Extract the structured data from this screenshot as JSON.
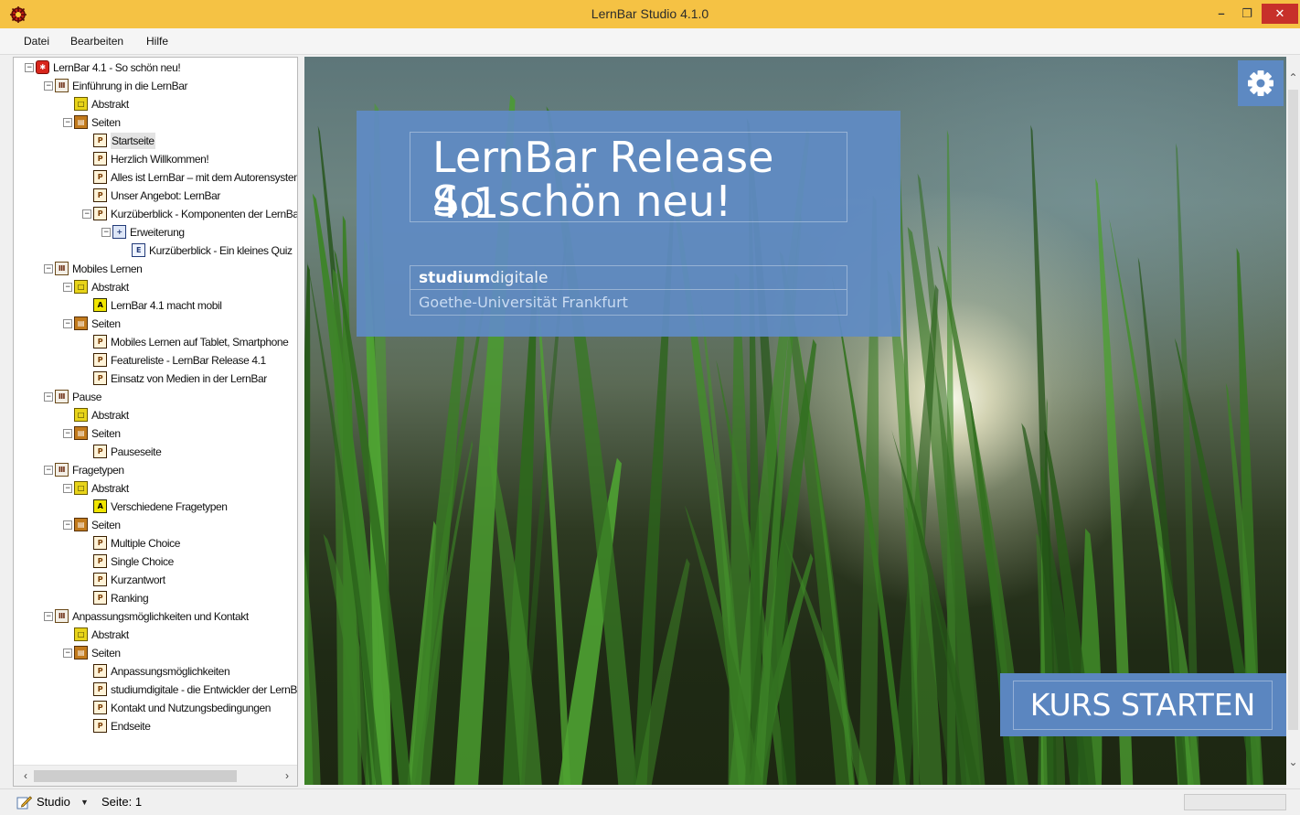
{
  "window": {
    "title": "LernBar Studio 4.1.0",
    "minimize_glyph": "–",
    "maximize_glyph": "❐",
    "close_glyph": "✕"
  },
  "menu": {
    "items": [
      {
        "label": "Datei"
      },
      {
        "label": "Bearbeiten"
      },
      {
        "label": "Hilfe"
      }
    ]
  },
  "tree": {
    "nodes": [
      {
        "label": "LernBar 4.1 - So schön neu!",
        "icon": "root-icon",
        "toggle": "−",
        "glyph": "✱"
      },
      {
        "label": "Einführung in die LernBar",
        "icon": "chapter-icon",
        "toggle": "−",
        "glyph": "Ⅲ"
      },
      {
        "label": "Abstrakt",
        "icon": "abstract-icon",
        "toggle": "",
        "glyph": "□"
      },
      {
        "label": "Seiten",
        "icon": "pages-icon",
        "toggle": "−",
        "glyph": "▤"
      },
      {
        "label": "Startseite",
        "icon": "page-icon",
        "toggle": "",
        "glyph": "P",
        "selected": true
      },
      {
        "label": "Herzlich Willkommen!",
        "icon": "page-icon",
        "toggle": "",
        "glyph": "P"
      },
      {
        "label": "Alles ist LernBar – mit dem Autorensystem",
        "icon": "page-icon",
        "toggle": "",
        "glyph": "P"
      },
      {
        "label": "Unser Angebot: LernBar",
        "icon": "page-icon",
        "toggle": "",
        "glyph": "P"
      },
      {
        "label": "Kurzüberblick - Komponenten der LernBar",
        "icon": "page-icon",
        "toggle": "−",
        "glyph": "P"
      },
      {
        "label": "Erweiterung",
        "icon": "extension-icon",
        "toggle": "−",
        "glyph": "+"
      },
      {
        "label": "Kurzüberblick - Ein kleines Quiz",
        "icon": "extension-page-icon",
        "toggle": "",
        "glyph": "E"
      },
      {
        "label": "Mobiles Lernen",
        "icon": "chapter-icon",
        "toggle": "−",
        "glyph": "Ⅲ"
      },
      {
        "label": "Abstrakt",
        "icon": "abstract-icon",
        "toggle": "−",
        "glyph": "□"
      },
      {
        "label": "LernBar 4.1 macht mobil",
        "icon": "abstract-page-icon",
        "toggle": "",
        "glyph": "A"
      },
      {
        "label": "Seiten",
        "icon": "pages-icon",
        "toggle": "−",
        "glyph": "▤"
      },
      {
        "label": "Mobiles Lernen auf Tablet, Smartphone",
        "icon": "page-icon",
        "toggle": "",
        "glyph": "P"
      },
      {
        "label": "Featureliste - LernBar Release 4.1",
        "icon": "page-icon",
        "toggle": "",
        "glyph": "P"
      },
      {
        "label": "Einsatz von Medien in der LernBar",
        "icon": "page-icon",
        "toggle": "",
        "glyph": "P"
      },
      {
        "label": "Pause",
        "icon": "chapter-icon",
        "toggle": "−",
        "glyph": "Ⅲ"
      },
      {
        "label": "Abstrakt",
        "icon": "abstract-icon",
        "toggle": "",
        "glyph": "□"
      },
      {
        "label": "Seiten",
        "icon": "pages-icon",
        "toggle": "−",
        "glyph": "▤"
      },
      {
        "label": "Pauseseite",
        "icon": "page-icon",
        "toggle": "",
        "glyph": "P"
      },
      {
        "label": "Fragetypen",
        "icon": "chapter-icon",
        "toggle": "−",
        "glyph": "Ⅲ"
      },
      {
        "label": "Abstrakt",
        "icon": "abstract-icon",
        "toggle": "−",
        "glyph": "□"
      },
      {
        "label": "Verschiedene Fragetypen",
        "icon": "abstract-page-icon",
        "toggle": "",
        "glyph": "A"
      },
      {
        "label": "Seiten",
        "icon": "pages-icon",
        "toggle": "−",
        "glyph": "▤"
      },
      {
        "label": "Multiple Choice",
        "icon": "page-icon",
        "toggle": "",
        "glyph": "P"
      },
      {
        "label": "Single Choice",
        "icon": "page-icon",
        "toggle": "",
        "glyph": "P"
      },
      {
        "label": "Kurzantwort",
        "icon": "page-icon",
        "toggle": "",
        "glyph": "P"
      },
      {
        "label": "Ranking",
        "icon": "page-icon",
        "toggle": "",
        "glyph": "P"
      },
      {
        "label": "Anpassungsmöglichkeiten und Kontakt",
        "icon": "chapter-icon",
        "toggle": "−",
        "glyph": "Ⅲ"
      },
      {
        "label": "Abstrakt",
        "icon": "abstract-icon",
        "toggle": "",
        "glyph": "□"
      },
      {
        "label": "Seiten",
        "icon": "pages-icon",
        "toggle": "−",
        "glyph": "▤"
      },
      {
        "label": "Anpassungsmöglichkeiten",
        "icon": "page-icon",
        "toggle": "",
        "glyph": "P"
      },
      {
        "label": "studiumdigitale - die Entwickler der LernBar",
        "icon": "page-icon",
        "toggle": "",
        "glyph": "P"
      },
      {
        "label": "Kontakt und Nutzungsbedingungen",
        "icon": "page-icon",
        "toggle": "",
        "glyph": "P"
      },
      {
        "label": "Endseite",
        "icon": "page-icon",
        "toggle": "",
        "glyph": "P"
      }
    ],
    "scroll_left": "‹",
    "scroll_right": "›"
  },
  "preview": {
    "title_line1": "LernBar Release 4.1",
    "title_line2": "So schön neu!",
    "org_bold": "studium",
    "org_light": "digitale",
    "university": "Goethe-Universität Frankfurt",
    "start_button": "KURS STARTEN",
    "settings_icon": "gear-icon",
    "scroll_up": "⌃",
    "scroll_down": "⌄"
  },
  "status": {
    "mode": "Studio",
    "mode_arrow": "▼",
    "page": "Seite: 1"
  },
  "colors": {
    "titlebar": "#f5c244",
    "close": "#c7302a",
    "overlay_blue": "#5b86c0"
  }
}
